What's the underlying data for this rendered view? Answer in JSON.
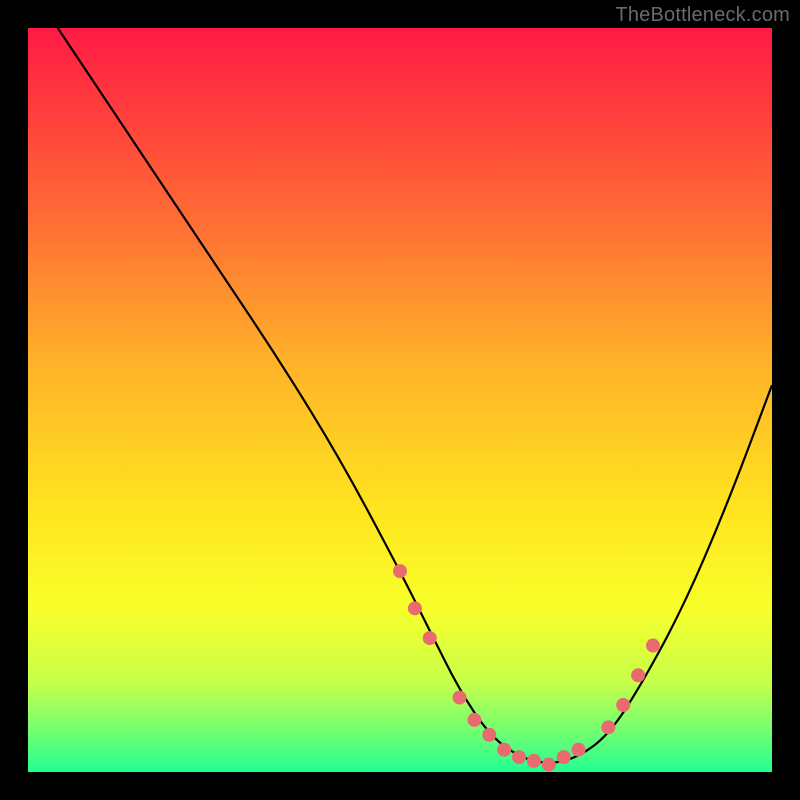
{
  "watermark": "TheBottleneck.com",
  "chart_data": {
    "type": "line",
    "title": "",
    "xlabel": "",
    "ylabel": "",
    "xlim": [
      0,
      100
    ],
    "ylim": [
      0,
      100
    ],
    "series": [
      {
        "name": "curve",
        "x": [
          4,
          10,
          18,
          26,
          34,
          42,
          50,
          54,
          58,
          62,
          66,
          70,
          74,
          78,
          82,
          88,
          94,
          100
        ],
        "values": [
          100,
          91,
          79,
          67,
          55,
          42,
          27,
          19,
          11,
          5,
          2,
          1,
          2,
          5,
          11,
          22,
          36,
          52
        ]
      }
    ],
    "markers": {
      "name": "dots",
      "x": [
        50,
        52,
        54,
        58,
        60,
        62,
        64,
        66,
        68,
        70,
        72,
        74,
        78,
        80,
        82,
        84
      ],
      "values": [
        27,
        22,
        18,
        10,
        7,
        5,
        3,
        2,
        1.5,
        1,
        2,
        3,
        6,
        9,
        13,
        17
      ]
    },
    "gradient_stops": [
      {
        "pos": 0,
        "color": "#ff1a44"
      },
      {
        "pos": 25,
        "color": "#ff6a35"
      },
      {
        "pos": 65,
        "color": "#ffe51f"
      },
      {
        "pos": 100,
        "color": "#1fff8f"
      }
    ]
  }
}
